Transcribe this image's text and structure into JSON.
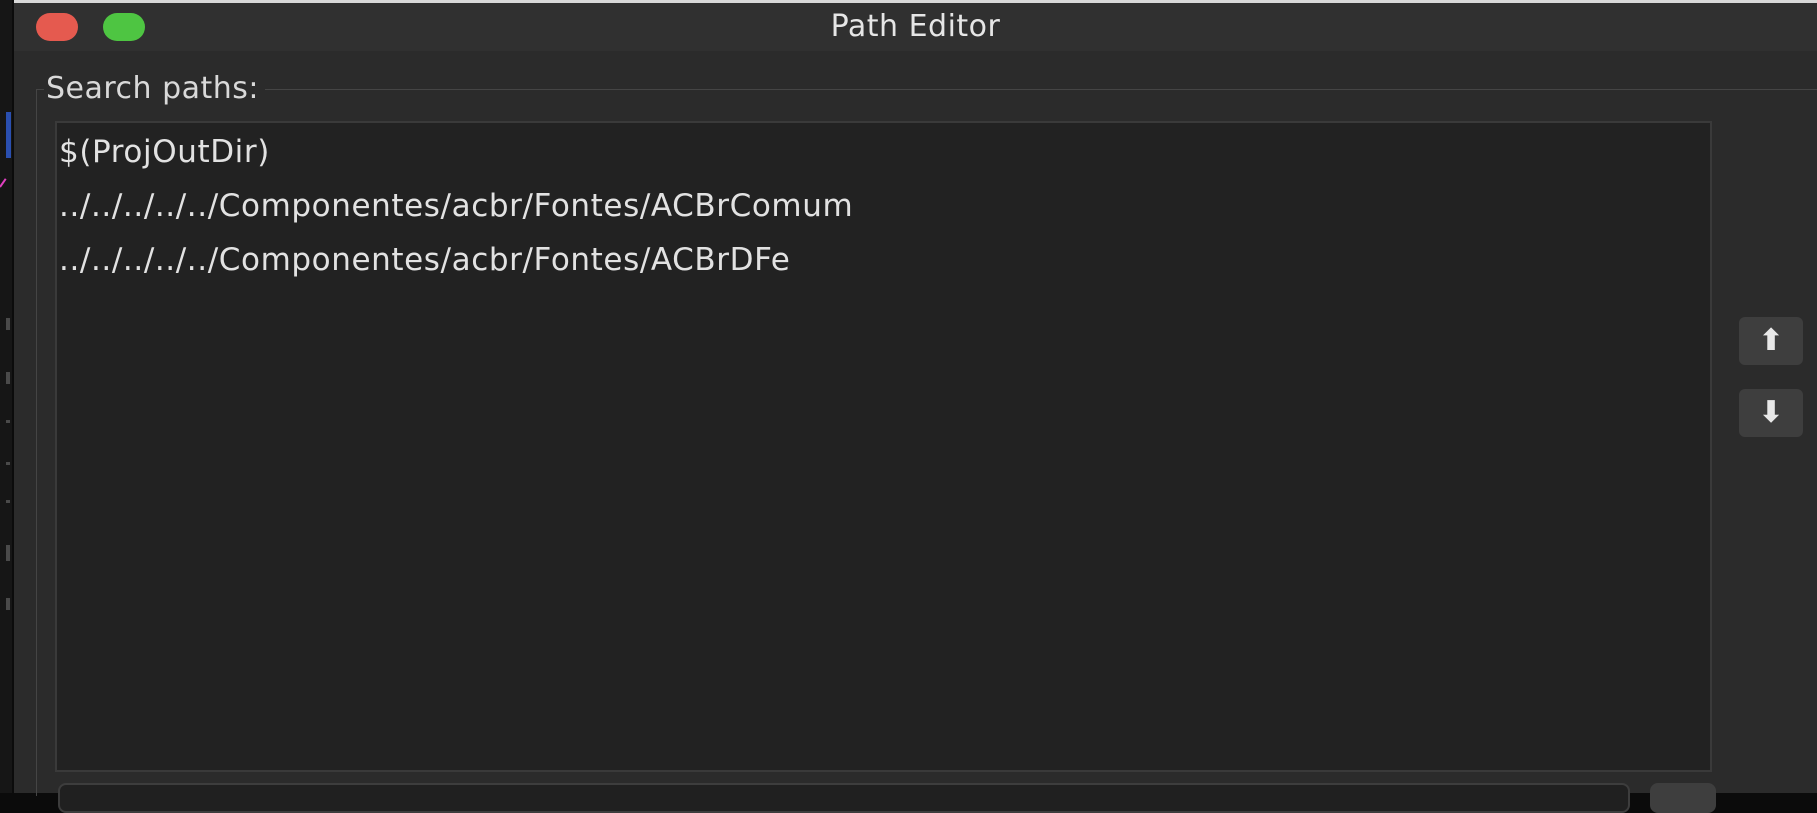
{
  "window": {
    "title": "Path Editor",
    "controls": {
      "close_color": "#e55a4f",
      "zoom_color": "#4ec542"
    }
  },
  "search_paths": {
    "label": "Search paths:",
    "items": [
      {
        "path": "$(ProjOutDir)"
      },
      {
        "path": "../../../../../Componentes/acbr/Fontes/ACBrComum"
      },
      {
        "path": "../../../../../Componentes/acbr/Fontes/ACBrDFe"
      }
    ]
  },
  "buttons": {
    "move_up_label": "⬆",
    "move_down_label": "⬇"
  },
  "colors": {
    "window_bg": "#2b2b2b",
    "list_bg": "#222222",
    "text": "#e2e2e2"
  }
}
